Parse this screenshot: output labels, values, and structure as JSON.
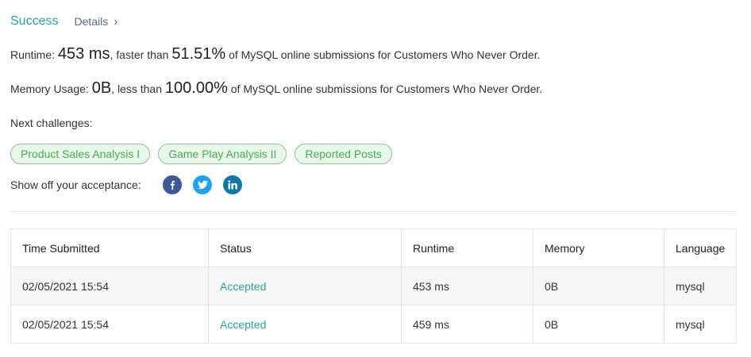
{
  "result": {
    "status": "Success",
    "details_label": "Details"
  },
  "runtime": {
    "label": "Runtime:",
    "value": "453 ms",
    "faster_text": ", faster than",
    "percent": "51.51%",
    "suffix": "of MySQL online submissions for Customers Who Never Order."
  },
  "memory": {
    "label": "Memory Usage:",
    "value": "0B",
    "less_text": ", less than",
    "percent": "100.00%",
    "suffix": "of MySQL online submissions for Customers Who Never Order."
  },
  "next_challenges": {
    "label": "Next challenges:",
    "items": [
      "Product Sales Analysis I",
      "Game Play Analysis II",
      "Reported Posts"
    ]
  },
  "share": {
    "label": "Show off your acceptance:",
    "icons": [
      "facebook-icon",
      "twitter-icon",
      "linkedin-icon"
    ]
  },
  "submissions": {
    "headers": [
      "Time Submitted",
      "Status",
      "Runtime",
      "Memory",
      "Language"
    ],
    "rows": [
      [
        "02/05/2021 15:54",
        "Accepted",
        "453 ms",
        "0B",
        "mysql"
      ],
      [
        "02/05/2021 15:54",
        "Accepted",
        "459 ms",
        "0B",
        "mysql"
      ]
    ]
  },
  "colors": {
    "accent": "#26a69a",
    "chip_text": "#4caf50",
    "chip_bg": "#e8f5e9",
    "facebook": "#3b5998",
    "twitter": "#1da1f2",
    "linkedin": "#0e76a8"
  }
}
